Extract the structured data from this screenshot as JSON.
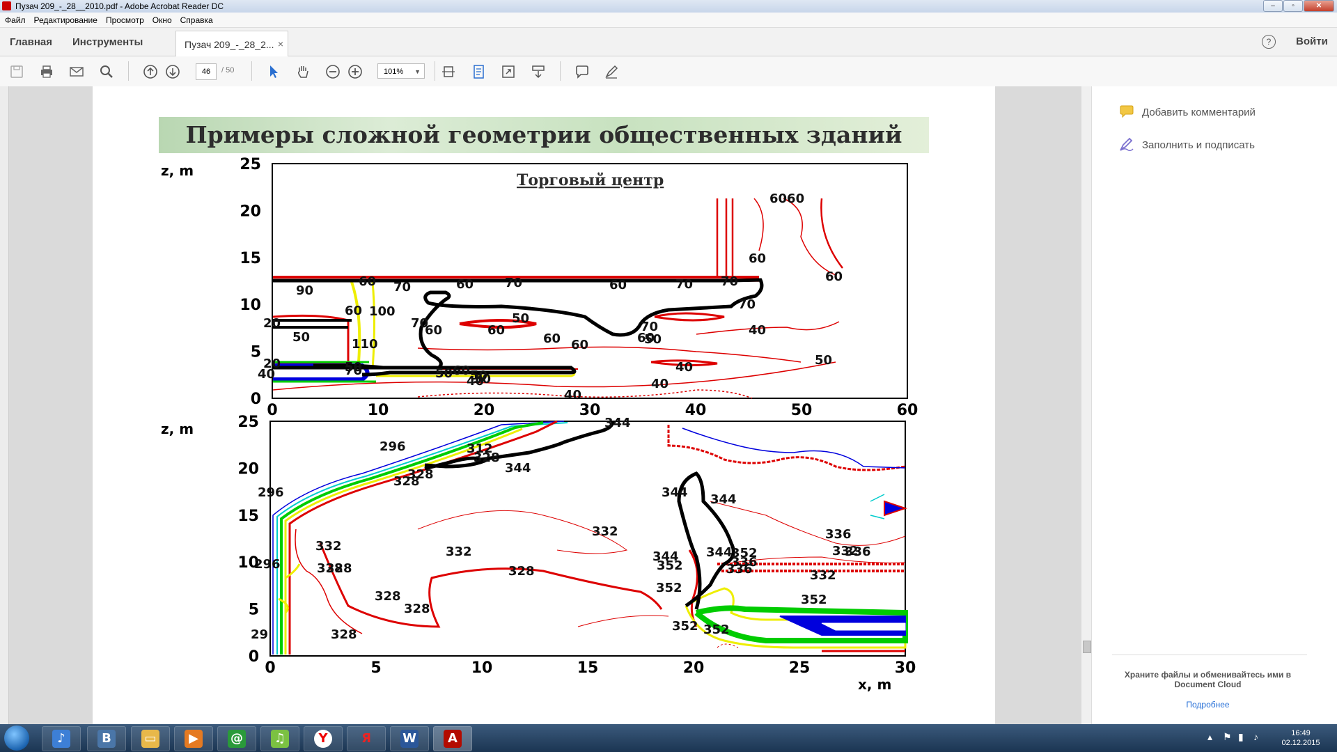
{
  "window": {
    "title": "Пузач 209_-_28__2010.pdf - Adobe Acrobat Reader DC"
  },
  "menu": [
    "Файл",
    "Редактирование",
    "Просмотр",
    "Окно",
    "Справка"
  ],
  "nav": {
    "home": "Главная",
    "tools": "Инструменты",
    "doc_tab": "Пузач 209_-_28_2...",
    "close_tab": "×",
    "sign_in": "Войти",
    "help": "?"
  },
  "toolbar": {
    "page_current": "46",
    "page_total": "/ 50",
    "zoom": "101%"
  },
  "right_panel": {
    "add_comment": "Добавить комментарий",
    "fill_sign": "Заполнить и подписать",
    "cloud_text": "Храните файлы и обменивайтесь ими в Document Cloud",
    "more_link": "Подробнее"
  },
  "taskbar": {
    "time": "16:49",
    "date": "02.12.2015"
  },
  "slide": {
    "title": "Примеры сложной геометрии общественных зданий"
  },
  "chart_data": [
    {
      "type": "contour",
      "title": "Торговый центр",
      "ylabel": "z, m",
      "ylim": [
        0,
        25
      ],
      "yticks": [
        "25",
        "20",
        "15",
        "10",
        "5",
        "0"
      ],
      "xlim": [
        0,
        60
      ],
      "xticks": [
        "0",
        "10",
        "20",
        "30",
        "40",
        "50",
        "60"
      ],
      "contour_labels": [
        "6060",
        "60",
        "60",
        "90",
        "60",
        "70",
        "60",
        "70",
        "60",
        "70",
        "70",
        "70",
        "100",
        "20",
        "60",
        "60",
        "70",
        "60",
        "50",
        "60",
        "60",
        "110",
        "60",
        "70",
        "50",
        "50",
        "20",
        "50",
        "70",
        "40",
        "50",
        "60",
        "50",
        "50",
        "40",
        "40",
        "40",
        "40",
        "40",
        "50"
      ]
    },
    {
      "type": "contour",
      "ylabel": "z, m",
      "xlabel": "x, m",
      "ylim": [
        0,
        25
      ],
      "yticks": [
        "25",
        "20",
        "15",
        "10",
        "5",
        "0"
      ],
      "xlim": [
        0,
        30
      ],
      "xticks": [
        "0",
        "5",
        "10",
        "15",
        "20",
        "25",
        "30"
      ],
      "contour_labels": [
        "344",
        "296",
        "328",
        "312",
        "328",
        "344",
        "296",
        "328",
        "332",
        "344",
        "344",
        "328",
        "336",
        "332",
        "332",
        "332",
        "336",
        "296",
        "328",
        "344",
        "344",
        "352",
        "336",
        "328",
        "352",
        "336",
        "332",
        "328",
        "352",
        "352",
        "29",
        "328",
        "352",
        "328",
        "352"
      ]
    }
  ]
}
